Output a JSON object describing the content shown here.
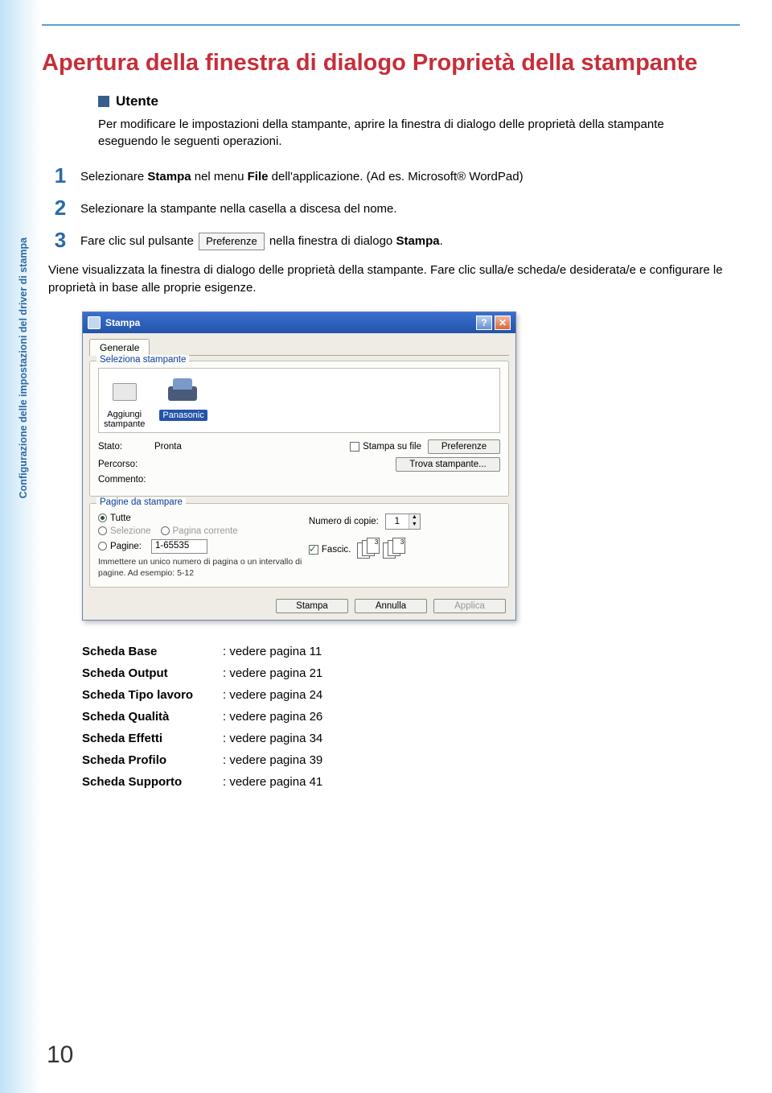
{
  "sidebar": {
    "text": "Configurazione\ndelle impostazioni\ndel driver di stampa"
  },
  "title": "Apertura della finestra di dialogo Proprietà della stampante",
  "section_heading": "Utente",
  "intro": "Per modificare le impostazioni della stampante, aprire la finestra di dialogo delle proprietà della stampante eseguendo le seguenti operazioni.",
  "steps": [
    {
      "num": "1",
      "pre": "Selezionare ",
      "bold1": "Stampa",
      "mid": " nel menu ",
      "bold2": "File",
      "post": " dell'applicazione. (Ad es. Microsoft® WordPad)"
    },
    {
      "num": "2",
      "text": "Selezionare la stampante nella casella a discesa del nome."
    },
    {
      "num": "3",
      "pre": "Fare clic sul pulsante ",
      "button": "Preferenze",
      "post": " nella finestra di dialogo ",
      "bold": "Stampa",
      "tail": "."
    }
  ],
  "note": "Viene visualizzata la finestra di dialogo delle proprietà della stampante. Fare clic sulla/e scheda/e desiderata/e e configurare le proprietà in base alle proprie esigenze.",
  "dlg": {
    "title": "Stampa",
    "tab": "Generale",
    "group1": "Seleziona stampante",
    "printer_add": "Aggiungi\nstampante",
    "printer_sel": "Panasonic",
    "state_lbl": "Stato:",
    "state_val": "Pronta",
    "path_lbl": "Percorso:",
    "comment_lbl": "Commento:",
    "print_to_file": "Stampa su file",
    "prefs_btn": "Preferenze",
    "find_btn": "Trova stampante...",
    "group2": "Pagine da stampare",
    "radio_all": "Tutte",
    "radio_sel": "Selezione",
    "radio_cur": "Pagina corrente",
    "radio_pages": "Pagine:",
    "pages_val": "1-65535",
    "pages_hint": "Immettere un unico numero di pagina o un intervallo di pagine. Ad esempio: 5-12",
    "copies_lbl": "Numero di copie:",
    "copies_val": "1",
    "collate": "Fascic.",
    "btn_print": "Stampa",
    "btn_cancel": "Annulla",
    "btn_apply": "Applica"
  },
  "refs": [
    {
      "label": "Scheda Base",
      "val": "vedere pagina 11"
    },
    {
      "label": "Scheda Output",
      "val": "vedere pagina 21"
    },
    {
      "label": "Scheda Tipo lavoro",
      "val": "vedere pagina 24"
    },
    {
      "label": "Scheda Qualità",
      "val": "vedere pagina 26"
    },
    {
      "label": "Scheda Effetti",
      "val": "vedere pagina 34"
    },
    {
      "label": "Scheda Profilo",
      "val": "vedere pagina 39"
    },
    {
      "label": "Scheda Supporto",
      "val": "vedere pagina 41"
    }
  ],
  "page_number": "10"
}
